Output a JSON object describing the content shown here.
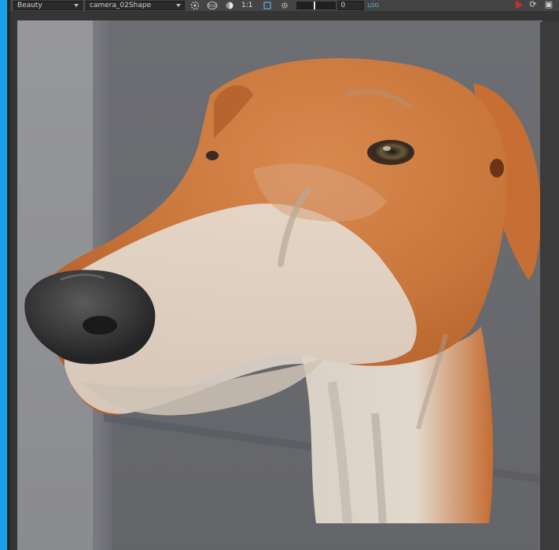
{
  "toolbar": {
    "aov_selected": "Beauty",
    "camera_selected": "camera_02Shape",
    "ratio_label": "1:1",
    "exposure_value": "0",
    "log_label": "LOG"
  },
  "icons": {
    "render_region": "render-region-icon",
    "color_icon": "color-swatch-icon",
    "crop_icon": "crop-icon",
    "settings": "settings-gear-icon",
    "play": "render-play-icon",
    "refresh": "refresh-icon",
    "snapshot": "snapshot-icon"
  },
  "colors": {
    "accent": "#1aa0e8",
    "play": "#d42a2a",
    "log": "#5aaedc"
  }
}
